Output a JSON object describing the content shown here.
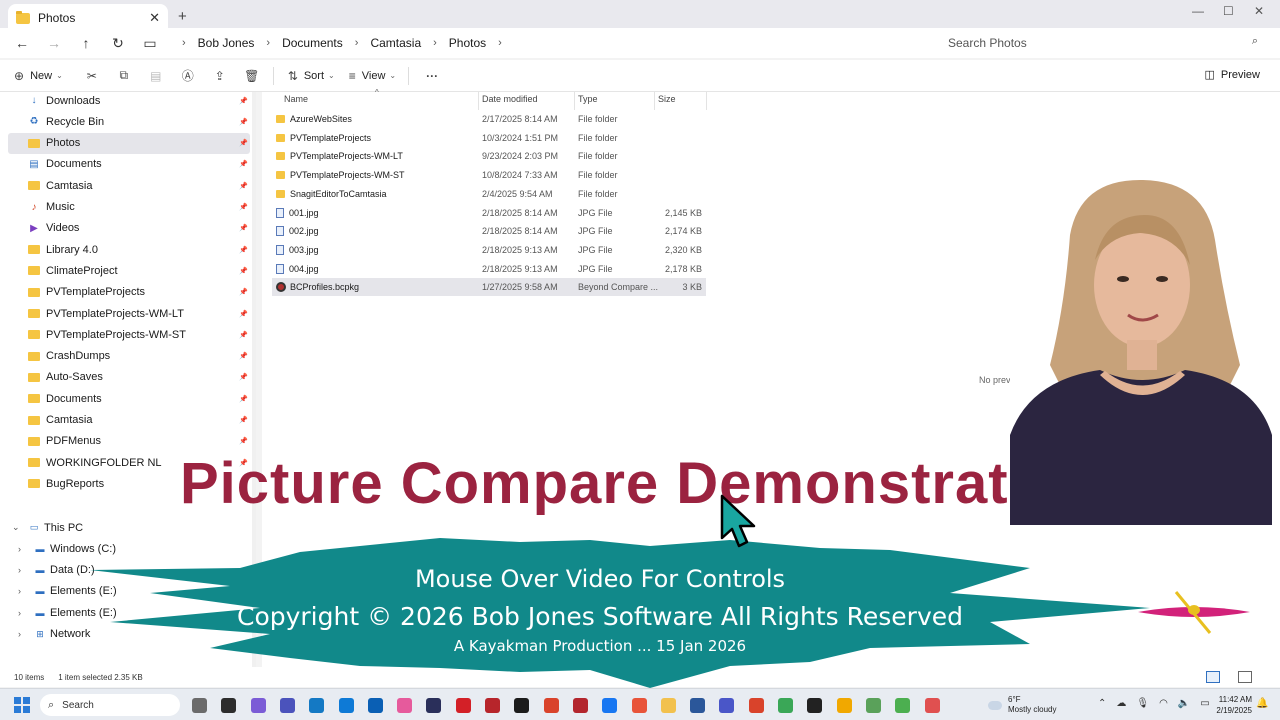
{
  "window": {
    "tab_title": "Photos",
    "tab_close": "✕",
    "new_tab": "+",
    "controls": {
      "minimize": "—",
      "maximize": "☐",
      "close": "✕"
    }
  },
  "address": {
    "breadcrumbs": [
      "Bob Jones",
      "Documents",
      "Camtasia",
      "Photos"
    ],
    "search_placeholder": "Search Photos"
  },
  "toolbar": {
    "new_label": "New",
    "sort_label": "Sort",
    "view_label": "View",
    "more": "···",
    "preview_label": "Preview"
  },
  "sidebar": {
    "items": [
      {
        "label": "Downloads",
        "icon": "download-icon",
        "pinned": true
      },
      {
        "label": "Recycle Bin",
        "icon": "recycle-bin-icon",
        "pinned": true
      },
      {
        "label": "Photos",
        "icon": "folder-icon",
        "pinned": true,
        "selected": true
      },
      {
        "label": "Documents",
        "icon": "documents-icon",
        "pinned": true
      },
      {
        "label": "Camtasia",
        "icon": "folder-icon",
        "pinned": true
      },
      {
        "label": "Music",
        "icon": "music-icon",
        "pinned": true
      },
      {
        "label": "Videos",
        "icon": "videos-icon",
        "pinned": true
      },
      {
        "label": "Library 4.0",
        "icon": "folder-icon",
        "pinned": true
      },
      {
        "label": "ClimateProject",
        "icon": "folder-icon",
        "pinned": true
      },
      {
        "label": "PVTemplateProjects",
        "icon": "folder-icon",
        "pinned": true
      },
      {
        "label": "PVTemplateProjects-WM-LT",
        "icon": "folder-icon",
        "pinned": true
      },
      {
        "label": "PVTemplateProjects-WM-ST",
        "icon": "folder-icon",
        "pinned": true
      },
      {
        "label": "CrashDumps",
        "icon": "folder-icon",
        "pinned": true
      },
      {
        "label": "Auto-Saves",
        "icon": "folder-icon",
        "pinned": true
      },
      {
        "label": "Documents",
        "icon": "folder-icon",
        "pinned": true
      },
      {
        "label": "Camtasia",
        "icon": "folder-icon",
        "pinned": true
      },
      {
        "label": "PDFMenus",
        "icon": "folder-icon",
        "pinned": true
      },
      {
        "label": "WORKINGFOLDER NL",
        "icon": "folder-icon",
        "pinned": true
      },
      {
        "label": "BugReports",
        "icon": "folder-icon",
        "pinned": true
      }
    ],
    "tree": [
      {
        "label": "This PC",
        "icon": "pc-icon",
        "expanded": true
      },
      {
        "label": "Windows (C:)",
        "icon": "drive-icon"
      },
      {
        "label": "Data (D:)",
        "icon": "drive-icon"
      },
      {
        "label": "Elements (E:)",
        "icon": "drive-icon"
      },
      {
        "label": "Elements (E:)",
        "icon": "drive-icon"
      },
      {
        "label": "Network",
        "icon": "network-icon"
      }
    ]
  },
  "files": {
    "columns": [
      "Name",
      "Date modified",
      "Type",
      "Size"
    ],
    "rows": [
      {
        "name": "AzureWebSites",
        "date": "2/17/2025 8:14 AM",
        "type": "File folder",
        "size": "",
        "kind": "folder"
      },
      {
        "name": "PVTemplateProjects",
        "date": "10/3/2024 1:51 PM",
        "type": "File folder",
        "size": "",
        "kind": "folder"
      },
      {
        "name": "PVTemplateProjects-WM-LT",
        "date": "9/23/2024 2:03 PM",
        "type": "File folder",
        "size": "",
        "kind": "folder"
      },
      {
        "name": "PVTemplateProjects-WM-ST",
        "date": "10/8/2024 7:33 AM",
        "type": "File folder",
        "size": "",
        "kind": "folder"
      },
      {
        "name": "SnagitEditorToCamtasia",
        "date": "2/4/2025 9:54 AM",
        "type": "File folder",
        "size": "",
        "kind": "folder"
      },
      {
        "name": "001.jpg",
        "date": "2/18/2025 8:14 AM",
        "type": "JPG File",
        "size": "2,145 KB",
        "kind": "jpg"
      },
      {
        "name": "002.jpg",
        "date": "2/18/2025 8:14 AM",
        "type": "JPG File",
        "size": "2,174 KB",
        "kind": "jpg"
      },
      {
        "name": "003.jpg",
        "date": "2/18/2025 9:13 AM",
        "type": "JPG File",
        "size": "2,320 KB",
        "kind": "jpg"
      },
      {
        "name": "004.jpg",
        "date": "2/18/2025 9:13 AM",
        "type": "JPG File",
        "size": "2,178 KB",
        "kind": "jpg"
      },
      {
        "name": "BCProfiles.bcpkg",
        "date": "1/27/2025 9:58 AM",
        "type": "Beyond Compare ...",
        "size": "3 KB",
        "kind": "pkg",
        "selected": true
      }
    ],
    "no_preview": "No preview a"
  },
  "status": {
    "items_count": "10 items",
    "selection": "1 item selected  2.35 KB"
  },
  "taskbar": {
    "search_label": "Search",
    "weather_temp": "6°F",
    "weather_desc": "Mostly cloudy",
    "time": "11:42 AM",
    "date": "2/19/2025",
    "app_colors": [
      "#6b6b6b",
      "#2d2d2d",
      "#7b5cd6",
      "#4b53bc",
      "#1479c4",
      "#0e7ad6",
      "#0a5fb4",
      "#e65a9c",
      "#2a2f5a",
      "#d32027",
      "#b7252b",
      "#1c1c1c",
      "#d9432b",
      "#b3262e",
      "#1877f2",
      "#e8543a",
      "#f2c14e",
      "#2b579a",
      "#4a56c8",
      "#d9432b",
      "#3aa757",
      "#222222",
      "#f1a800",
      "#5aa15a",
      "#4caf50",
      "#e05050"
    ]
  },
  "overlay": {
    "title": "Picture Compare Demonstrat",
    "banner_line1": "Mouse Over Video For Controls",
    "banner_line2": "Copyright © 2026 Bob Jones Software All Rights Reserved",
    "banner_line3": "A Kayakman Production ... 15 Jan 2026",
    "title_color": "#9b2340",
    "banner_color": "#11898a"
  }
}
